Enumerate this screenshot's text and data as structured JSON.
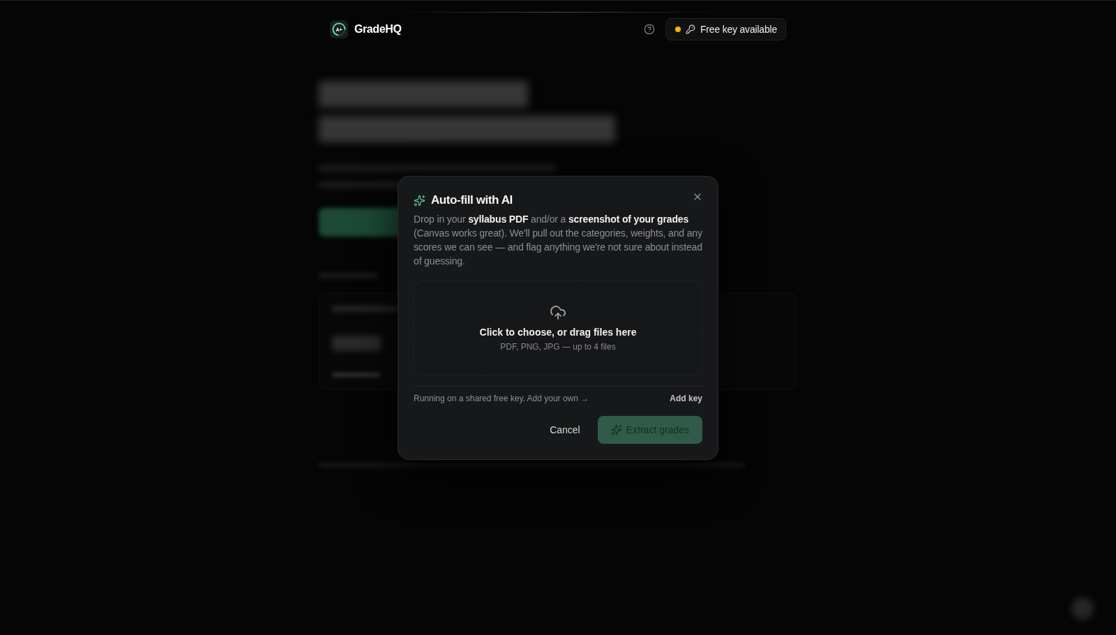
{
  "header": {
    "logo": {
      "mark": "A+",
      "name": "GradeHQ"
    },
    "key_badge": {
      "label": "Free key available"
    }
  },
  "dialog": {
    "title": "Auto-fill with AI",
    "description": "Drop in your **syllabus PDF** and/or a **screenshot of your grades** (Canvas works great). We'll pull out the categories, weights, and any scores we can see — and flag anything we're not sure about instead of guessing.",
    "dropzone": {
      "title": "Click to choose, or drag files here",
      "hint": "PDF, PNG, JPG — up to 4 files"
    },
    "key_note": "Running on a shared free key. Add your own →",
    "add_key": "Add key",
    "cancel": "Cancel",
    "submit": {
      "label": "Extract grades",
      "disabled": true
    }
  }
}
